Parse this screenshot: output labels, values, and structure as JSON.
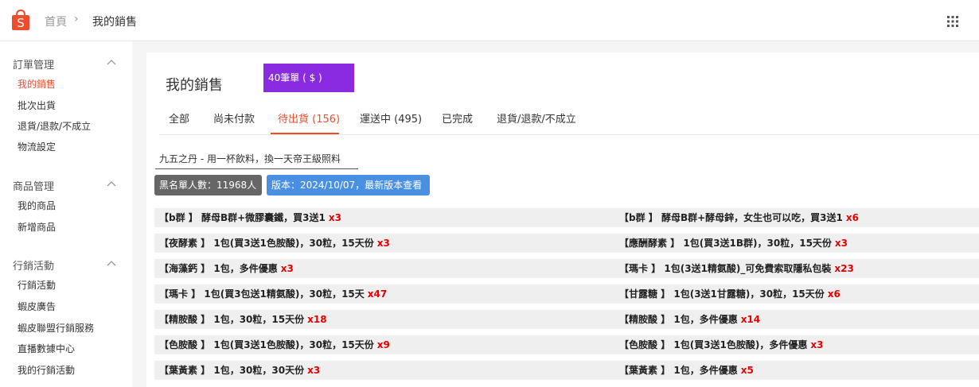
{
  "header": {
    "logo_letter": "S",
    "breadcrumb_home": "首頁",
    "breadcrumb_sep": "›",
    "breadcrumb_current": "我的銷售"
  },
  "sidebar": {
    "sections": [
      {
        "title": "訂單管理",
        "items": [
          {
            "label": "我的銷售",
            "active": true
          },
          {
            "label": "批次出貨"
          },
          {
            "label": "退貨/退款/不成立"
          },
          {
            "label": "物流設定"
          }
        ]
      },
      {
        "title": "商品管理",
        "items": [
          {
            "label": "我的商品"
          },
          {
            "label": "新增商品"
          }
        ]
      },
      {
        "title": "行銷活動",
        "items": [
          {
            "label": "行銷活動"
          },
          {
            "label": "蝦皮廣告"
          },
          {
            "label": "蝦皮聯盟行銷服務"
          },
          {
            "label": "直播數據中心"
          },
          {
            "label": "我的行銷活動"
          }
        ]
      }
    ]
  },
  "main": {
    "title": "我的銷售",
    "badge": "40筆單 ( $          )",
    "tabs": [
      {
        "label": "全部"
      },
      {
        "label": "尚未付款"
      },
      {
        "label": "待出貨 (156)",
        "active": true
      },
      {
        "label": "運送中 (495)"
      },
      {
        "label": "已完成"
      },
      {
        "label": "退貨/退款/不成立"
      }
    ],
    "notice": "九五之丹 - 用一杯飲料，換一天帝王級照料",
    "blacklist": "黑名單人數：11968人",
    "version": "版本：2024/10/07，最新版本查看"
  },
  "products": [
    {
      "left": {
        "text": "【b群 】 酵母B群+微膠囊鐵，買3送1",
        "qty": "x3"
      },
      "right": {
        "text": "【b群 】 酵母B群+酵母鋅，女生也可以吃，買3送1",
        "qty": "x6"
      }
    },
    {
      "left": {
        "text": "【夜酵素 】 1包(買3送1色胺酸)，30粒，15天份",
        "qty": "x3"
      },
      "right": {
        "text": "【應酬酵素 】 1包(買3送1B群)，30粒，15天份",
        "qty": "x3"
      }
    },
    {
      "left": {
        "text": "【海藻鈣 】 1包，多件優惠",
        "qty": "x3"
      },
      "right": {
        "text": "【瑪卡 】 1包(3送1精氨酸)_可免費索取隱私包裝",
        "qty": "x23"
      }
    },
    {
      "left": {
        "text": "【瑪卡 】 1包(買3包送1精氨酸)，30粒，15天",
        "qty": "x47"
      },
      "right": {
        "text": "【甘露糖 】 1包(3送1甘露糖)，30粒，15天份",
        "qty": "x6"
      }
    },
    {
      "left": {
        "text": "【精胺酸 】 1包，30粒，15天份",
        "qty": "x18"
      },
      "right": {
        "text": "【精胺酸 】 1包，多件優惠",
        "qty": "x14"
      }
    },
    {
      "left": {
        "text": "【色胺酸 】 1包(買3送1色胺酸)，30粒，15天份",
        "qty": "x9"
      },
      "right": {
        "text": "【色胺酸 】 1包(買3送1色胺酸)，多件優惠",
        "qty": "x3"
      }
    },
    {
      "left": {
        "text": "【葉黃素 】 1包，30粒，30天份",
        "qty": "x3"
      },
      "right": {
        "text": "【葉黃素 】 1包，多件優惠",
        "qty": "x5"
      }
    }
  ]
}
